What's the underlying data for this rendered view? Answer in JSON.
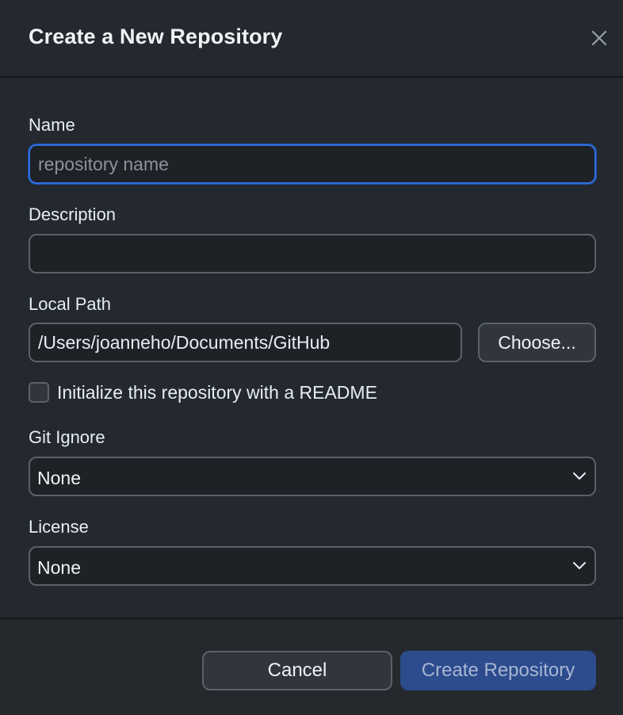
{
  "dialog": {
    "title": "Create a New Repository"
  },
  "form": {
    "name": {
      "label": "Name",
      "value": "",
      "placeholder": "repository name"
    },
    "description": {
      "label": "Description",
      "value": "",
      "placeholder": ""
    },
    "local_path": {
      "label": "Local Path",
      "value": "/Users/joanneho/Documents/GitHub",
      "choose_label": "Choose..."
    },
    "readme": {
      "label": "Initialize this repository with a README",
      "checked": false
    },
    "git_ignore": {
      "label": "Git Ignore",
      "selected": "None"
    },
    "license": {
      "label": "License",
      "selected": "None"
    }
  },
  "footer": {
    "cancel_label": "Cancel",
    "create_label": "Create Repository"
  },
  "icons": {
    "close": "close-icon",
    "chevron": "chevron-down-icon"
  },
  "colors": {
    "background": "#24292f",
    "focus_border": "#2f6fe0",
    "primary_button": "#2c4c8e"
  }
}
